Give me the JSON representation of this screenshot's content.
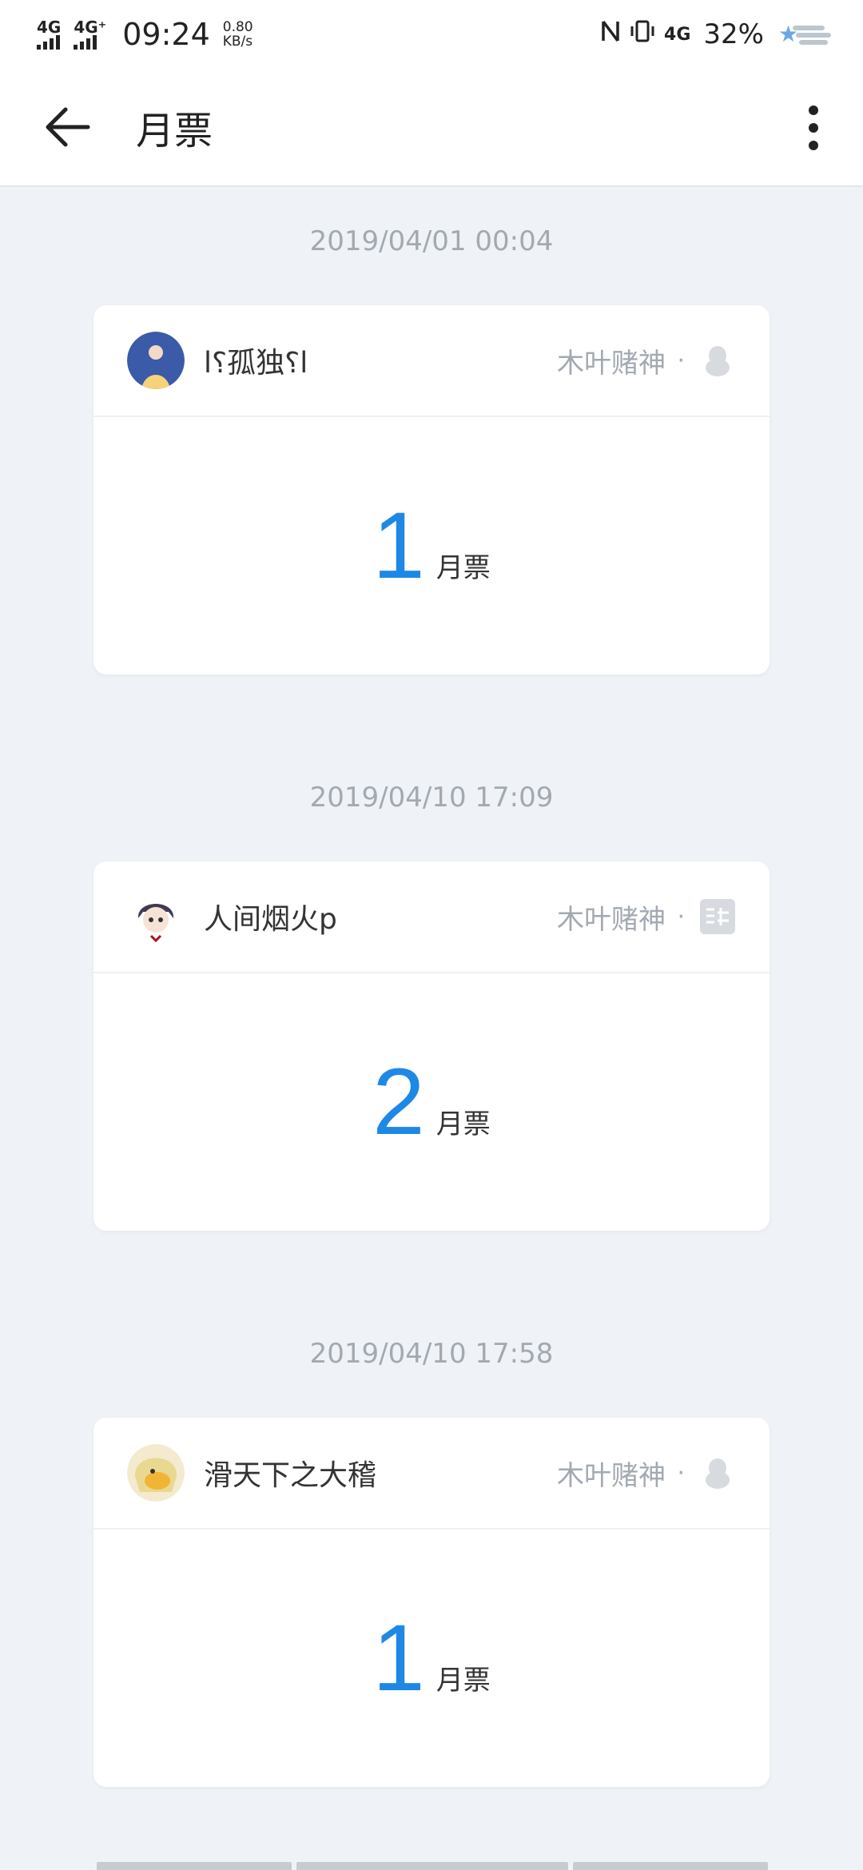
{
  "status_bar": {
    "signal1": "4G",
    "signal2": "4G⁺",
    "time": "09:24",
    "speed_value": "0.80",
    "speed_unit": "KB/s",
    "network": "4G",
    "battery": "32%"
  },
  "header": {
    "title": "月票",
    "back_icon": "arrow-left-icon",
    "more_icon": "more-vertical-icon"
  },
  "entries": [
    {
      "time": "2019/04/01 00:04",
      "user": "ا⸮孤独⸮ا",
      "author": "木叶赌神",
      "platform_icon": "qq-penguin-icon",
      "amount": "1",
      "unit": "月票"
    },
    {
      "time": "2019/04/10 17:09",
      "user": "人间烟火p",
      "author": "木叶赌神",
      "platform_icon": "qidian-app-icon",
      "amount": "2",
      "unit": "月票"
    },
    {
      "time": "2019/04/10 17:58",
      "user": "滑天下之大稽",
      "author": "木叶赌神",
      "platform_icon": "qq-penguin-icon",
      "amount": "1",
      "unit": "月票"
    }
  ],
  "colors": {
    "accent": "#1e88e5",
    "background": "#eff3f7",
    "muted_text": "#a2a9b1"
  }
}
